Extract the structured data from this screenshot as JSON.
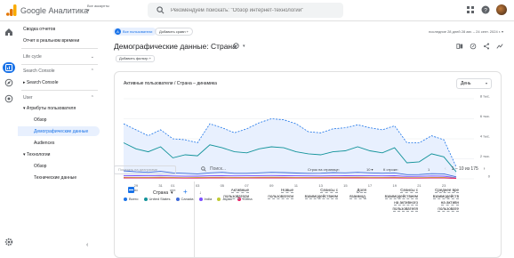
{
  "topbar": {
    "brand": "Google Аналитика",
    "accounts_label": "Все аккаунты",
    "search_placeholder": "Рекомендуем поискать: \"Обзор интернет-технологий\"",
    "icons": [
      "apps-icon",
      "help-icon",
      "avatar"
    ]
  },
  "rail": {
    "icons": [
      "home-icon",
      "reports-icon",
      "explore-icon",
      "advertising-icon",
      "settings-icon"
    ]
  },
  "nav": {
    "items": [
      {
        "label": "Сводка отчетов"
      },
      {
        "label": "Отчет в реальном времени"
      },
      {
        "label": "Life cycle"
      },
      {
        "label": "Search Console"
      },
      {
        "label": "Search Console"
      },
      {
        "label": "User"
      },
      {
        "label": "Атрибуты пользователя"
      },
      {
        "label": "Обзор"
      },
      {
        "label": "Демографические данные"
      },
      {
        "label": "Audiences"
      },
      {
        "label": "Технологии"
      },
      {
        "label": "Обзор"
      },
      {
        "label": "Технические данные"
      }
    ],
    "collapse_glyph": "‹"
  },
  "main": {
    "segment_chip": "Все пользователи",
    "segment_letter": "A",
    "add_comparison": "Добавить сравн +",
    "daterange": "последние 28 дней  28 авг. – 24 сент. 2024 г.  ▾",
    "title": "Демографические данные: Страна",
    "add_filter": "Добавить фильтр +"
  },
  "chart_card": {
    "title": "Активные пользователи / Страна – динамика",
    "period": "День",
    "period_caret": "▾"
  },
  "chart_data": {
    "type": "line",
    "x": [
      "28 авг.",
      "29",
      "30",
      "31",
      "01 сент.",
      "02",
      "03",
      "04",
      "05",
      "06",
      "07",
      "08",
      "09",
      "10",
      "11",
      "12",
      "13",
      "14",
      "15",
      "16",
      "17",
      "18",
      "19",
      "20",
      "21",
      "22",
      "23",
      "24"
    ],
    "xtick_labels": [
      {
        "label": "29",
        "sub": "авг.",
        "i": 1
      },
      {
        "label": "31",
        "sub": "",
        "i": 3
      },
      {
        "label": "01",
        "sub": "сент.",
        "i": 4
      },
      {
        "label": "03",
        "sub": "",
        "i": 6
      },
      {
        "label": "05",
        "sub": "",
        "i": 8
      },
      {
        "label": "07",
        "sub": "",
        "i": 10
      },
      {
        "label": "09",
        "sub": "",
        "i": 12
      },
      {
        "label": "11",
        "sub": "",
        "i": 14
      },
      {
        "label": "13",
        "sub": "",
        "i": 16
      },
      {
        "label": "15",
        "sub": "",
        "i": 18
      },
      {
        "label": "17",
        "sub": "",
        "i": 20
      },
      {
        "label": "19",
        "sub": "",
        "i": 22
      },
      {
        "label": "21",
        "sub": "",
        "i": 24
      },
      {
        "label": "23",
        "sub": "",
        "i": 26
      }
    ],
    "yticks": [
      {
        "v": 0,
        "label": "0"
      },
      {
        "v": 2000,
        "label": "2 тыс."
      },
      {
        "v": 4000,
        "label": "4 тыс."
      },
      {
        "v": 6000,
        "label": "6 тыс."
      },
      {
        "v": 8000,
        "label": "8 тыс."
      }
    ],
    "ylim": [
      0,
      8000
    ],
    "grid": true,
    "series": [
      {
        "name": "Всего",
        "color": "#1a73e8",
        "dashed": true,
        "fill": true,
        "values": [
          5500,
          4900,
          4300,
          4900,
          4000,
          3900,
          3600,
          5500,
          5100,
          4600,
          5000,
          5600,
          6000,
          5900,
          5500,
          4700,
          4600,
          5000,
          5100,
          5400,
          5100,
          4900,
          5300,
          3600,
          3600,
          4300,
          3900,
          1200
        ]
      },
      {
        "name": "United States",
        "color": "#12939a",
        "values": [
          3600,
          3000,
          2700,
          3200,
          2100,
          2400,
          2300,
          3400,
          3100,
          2700,
          2600,
          3000,
          3200,
          3100,
          2700,
          2500,
          2400,
          2700,
          2800,
          3200,
          2800,
          2600,
          3100,
          1600,
          1700,
          2500,
          2200,
          700
        ]
      },
      {
        "name": "Canada",
        "color": "#3f6ad8",
        "values": [
          800,
          700,
          650,
          750,
          600,
          550,
          500,
          600,
          650,
          550,
          550,
          600,
          650,
          620,
          580,
          550,
          560,
          620,
          600,
          650,
          600,
          560,
          600,
          420,
          430,
          520,
          500,
          200
        ]
      },
      {
        "name": "India",
        "color": "#7c4dff",
        "values": [
          300,
          320,
          300,
          330,
          280,
          260,
          270,
          300,
          310,
          290,
          300,
          320,
          330,
          310,
          300,
          290,
          280,
          300,
          310,
          320,
          300,
          290,
          310,
          240,
          250,
          280,
          270,
          100
        ]
      },
      {
        "name": "Japan",
        "color": "#c0ca33",
        "values": [
          150,
          140,
          130,
          160,
          130,
          120,
          130,
          150,
          150,
          140,
          140,
          150,
          160,
          150,
          140,
          140,
          130,
          150,
          150,
          160,
          150,
          140,
          150,
          120,
          120,
          140,
          130,
          60
        ]
      },
      {
        "name": "China",
        "color": "#e91e63",
        "values": [
          90,
          80,
          80,
          90,
          80,
          70,
          70,
          90,
          90,
          80,
          80,
          90,
          90,
          90,
          80,
          80,
          80,
          90,
          90,
          90,
          80,
          80,
          90,
          70,
          70,
          80,
          80,
          40
        ]
      }
    ],
    "legend_entries": [
      "Всего",
      "United States",
      "Canada",
      "India",
      "Japan",
      "China"
    ]
  },
  "table": {
    "search_placeholder": "Показать на диаграмме",
    "search_label": "Поиск...",
    "rows_per_page_label": "Строк на странице:",
    "rows_per_page_value": "10 ▾",
    "goto_label": "К строке:",
    "goto_value": "1",
    "pager_text": "1 – 10 из 175",
    "prev": "‹",
    "next": "›",
    "dimension": "Страна",
    "dimension_caret": "▾",
    "add_dim": "+",
    "sort_icon": "↓",
    "columns": [
      {
        "l1": "Активные",
        "l2": "пользователи",
        "l3": "",
        "l4": ""
      },
      {
        "l1": "Новые",
        "l2": "пользователи",
        "l3": "",
        "l4": ""
      },
      {
        "l1": "Сеансы с",
        "l2": "взаимодействием",
        "l3": "",
        "l4": ""
      },
      {
        "l1": "Доля",
        "l2": "взаимод.",
        "l3": "",
        "l4": ""
      },
      {
        "l1": "Сеансы с",
        "l2": "взаимодействием",
        "l3": "на активного",
        "l4": "пользователя"
      },
      {
        "l1": "Среднее вре",
        "l2": "взаимодейств",
        "l3": "на активн",
        "l4": "пользовате"
      }
    ]
  }
}
